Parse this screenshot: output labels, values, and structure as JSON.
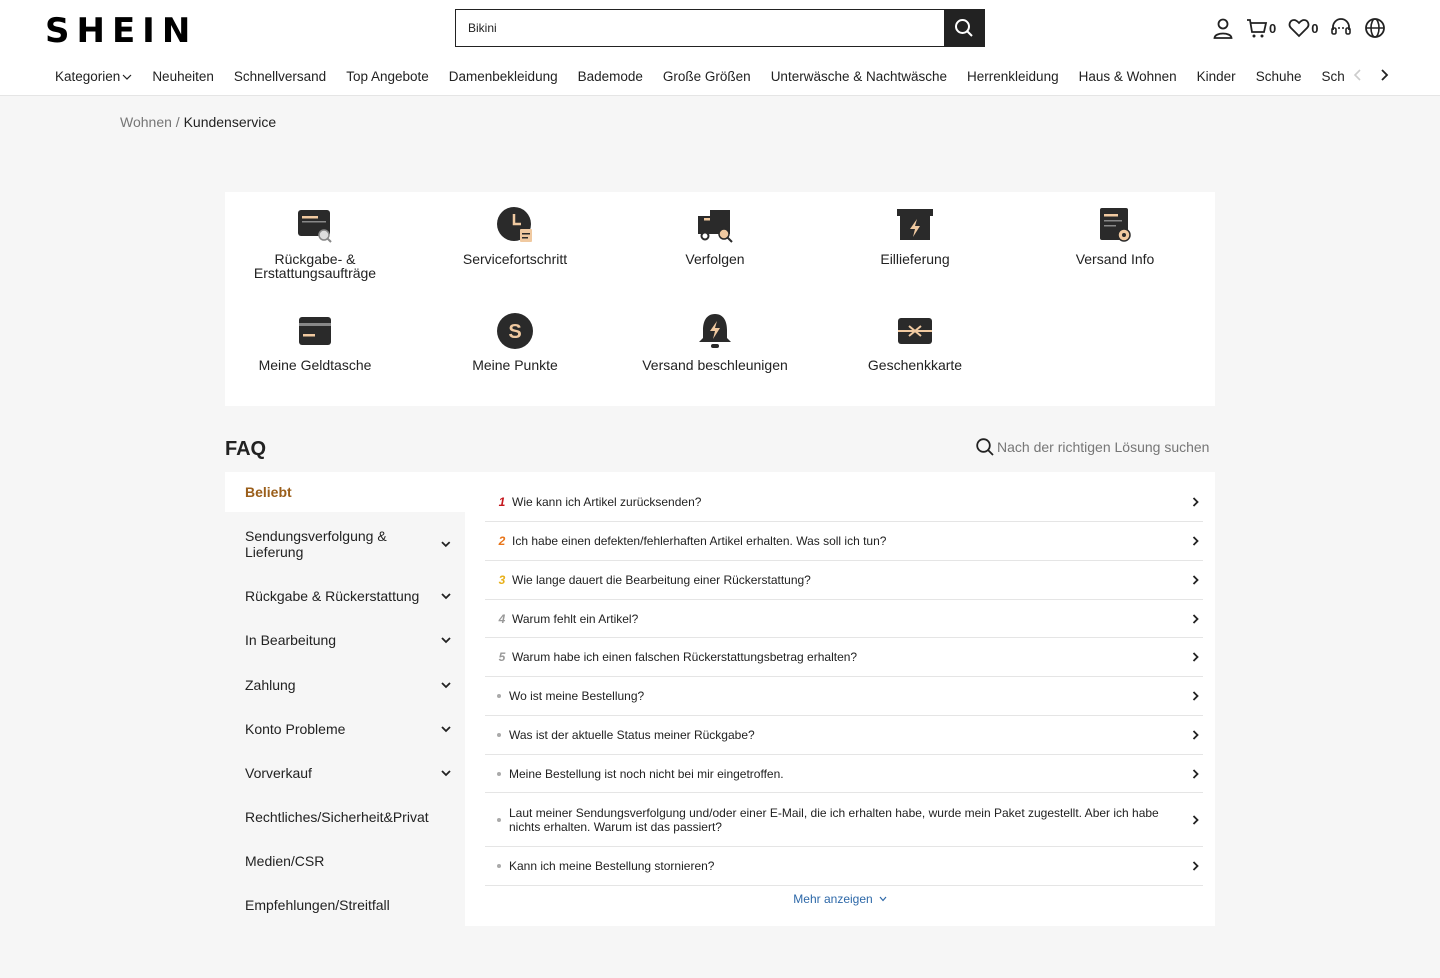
{
  "header": {
    "logo": "SHEIN",
    "search_value": "Bikini",
    "cart_count": "0",
    "wishlist_count": "0"
  },
  "nav": [
    "Kategorien",
    "Neuheiten",
    "Schnellversand",
    "Top Angebote",
    "Damenbekleidung",
    "Bademode",
    "Große Größen",
    "Unterwäsche & Nachtwäsche",
    "Herrenkleidung",
    "Haus & Wohnen",
    "Kinder",
    "Schuhe",
    "Sch"
  ],
  "breadcrumb": {
    "parent": "Wohnen",
    "separator": "/",
    "current": "Kundenservice"
  },
  "services": [
    {
      "label": "Rückgabe- & Erstattungsaufträge",
      "icon": "card-search-icon"
    },
    {
      "label": "Servicefortschritt",
      "icon": "clock-doc-icon"
    },
    {
      "label": "Verfolgen",
      "icon": "truck-search-icon"
    },
    {
      "label": "Eillieferung",
      "icon": "lightning-box-icon"
    },
    {
      "label": "Versand Info",
      "icon": "doc-lock-icon"
    },
    {
      "label": "Meine Geldtasche",
      "icon": "wallet-card-icon"
    },
    {
      "label": "Meine Punkte",
      "icon": "points-coin-icon"
    },
    {
      "label": "Versand beschleunigen",
      "icon": "bell-lightning-icon"
    },
    {
      "label": "Geschenkkarte",
      "icon": "gift-card-icon"
    }
  ],
  "faq": {
    "title": "FAQ",
    "search_placeholder": "Nach der richtigen Lösung suchen",
    "categories": [
      {
        "label": "Beliebt",
        "expandable": false
      },
      {
        "label": "Sendungsverfolgung & Lieferung",
        "expandable": true
      },
      {
        "label": "Rückgabe & Rückerstattung",
        "expandable": true
      },
      {
        "label": "In Bearbeitung",
        "expandable": true
      },
      {
        "label": "Zahlung",
        "expandable": true
      },
      {
        "label": "Konto Probleme",
        "expandable": true
      },
      {
        "label": "Vorverkauf",
        "expandable": true
      },
      {
        "label": "Rechtliches/Sicherheit&Privat",
        "expandable": false
      },
      {
        "label": "Medien/CSR",
        "expandable": false
      },
      {
        "label": "Empfehlungen/Streitfall",
        "expandable": false
      }
    ],
    "questions": [
      {
        "rank": "1",
        "rank_color": "#c4161c",
        "text": "Wie kann ich Artikel zurücksenden?"
      },
      {
        "rank": "2",
        "rank_color": "#e8751a",
        "text": "Ich habe einen defekten/fehlerhaften Artikel erhalten. Was soll ich tun?"
      },
      {
        "rank": "3",
        "rank_color": "#e8b01a",
        "text": "Wie lange dauert die Bearbeitung einer Rückerstattung?"
      },
      {
        "rank": "4",
        "rank_color": "#999999",
        "text": "Warum fehlt ein Artikel?"
      },
      {
        "rank": "5",
        "rank_color": "#999999",
        "text": "Warum habe ich einen falschen Rückerstattungsbetrag erhalten?"
      },
      {
        "rank": "",
        "rank_color": "",
        "text": "Wo ist meine Bestellung?"
      },
      {
        "rank": "",
        "rank_color": "",
        "text": "Was ist der aktuelle Status meiner Rückgabe?"
      },
      {
        "rank": "",
        "rank_color": "",
        "text": "Meine Bestellung ist noch nicht bei mir eingetroffen."
      },
      {
        "rank": "",
        "rank_color": "",
        "text": "Laut meiner Sendungsverfolgung und/oder einer E-Mail, die ich erhalten habe, wurde mein Paket zugestellt. Aber ich habe nichts erhalten. Warum ist das passiert?"
      },
      {
        "rank": "",
        "rank_color": "",
        "text": "Kann ich meine Bestellung stornieren?"
      }
    ],
    "more_label": "Mehr anzeigen"
  },
  "colors": {
    "accent": "#9a5e1a",
    "link": "#2d68a8",
    "icon_accent": "#f0c9a0"
  }
}
